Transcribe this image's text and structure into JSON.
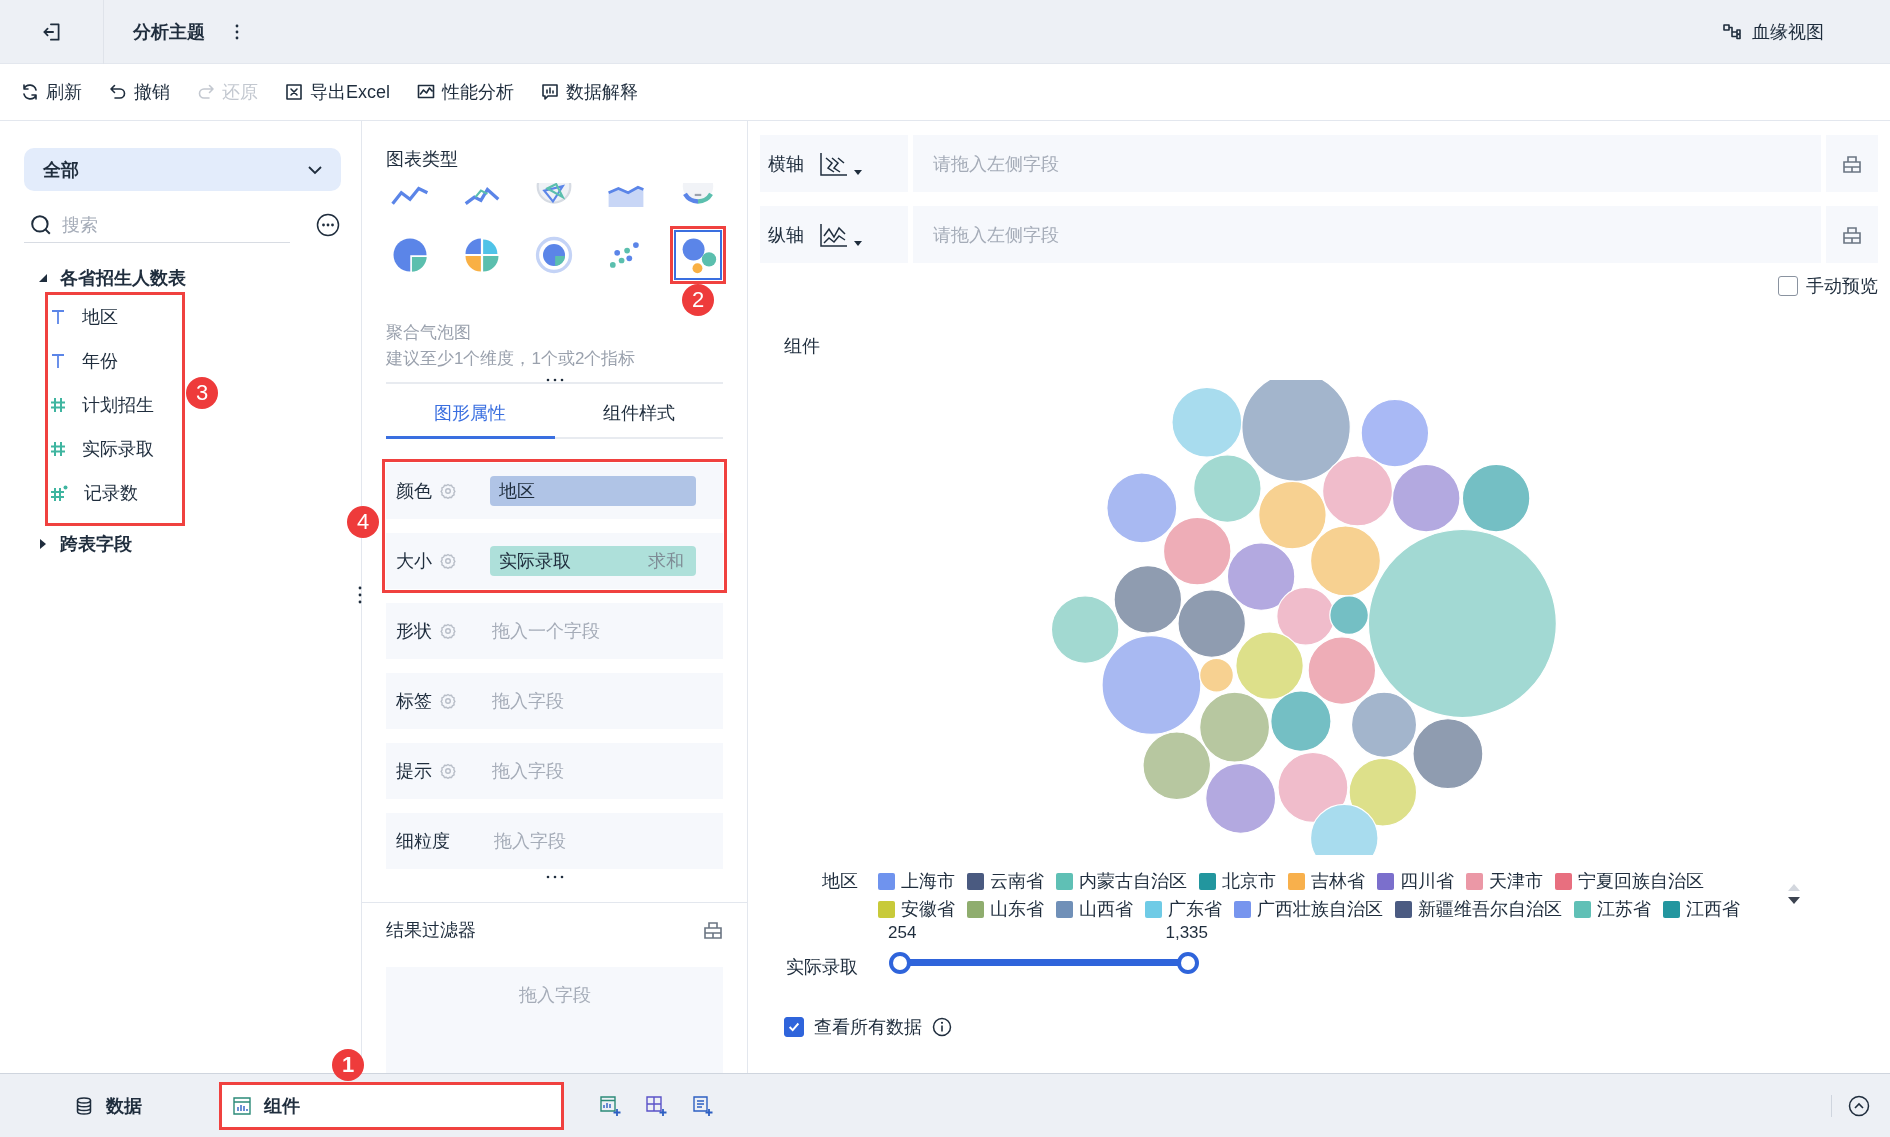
{
  "topbar": {
    "title": "分析主题",
    "lineage": "血缘视图"
  },
  "toolbar": [
    {
      "label": "刷新",
      "disabled": false
    },
    {
      "label": "撤销",
      "disabled": false
    },
    {
      "label": "还原",
      "disabled": true
    },
    {
      "label": "导出Excel",
      "disabled": false
    },
    {
      "label": "性能分析",
      "disabled": false
    },
    {
      "label": "数据解释",
      "disabled": false
    }
  ],
  "data_panel": {
    "scope": "全部",
    "search": {
      "placeholder": "搜索"
    },
    "tables": [
      {
        "name": "各省招生人数表",
        "expanded": true,
        "callout": "3",
        "fields": [
          {
            "name": "地区",
            "kind": "text"
          },
          {
            "name": "年份",
            "kind": "text"
          },
          {
            "name": "计划招生",
            "kind": "number"
          },
          {
            "name": "实际录取",
            "kind": "number"
          },
          {
            "name": "记录数",
            "kind": "count"
          }
        ]
      },
      {
        "name": "跨表字段",
        "expanded": false
      }
    ]
  },
  "chart_types": {
    "title": "图表类型",
    "items": [
      {
        "kind": "line",
        "selected": false
      },
      {
        "kind": "multiline",
        "selected": false
      },
      {
        "kind": "radar",
        "selected": false
      },
      {
        "kind": "area",
        "selected": false
      },
      {
        "kind": "gauge",
        "selected": false
      },
      {
        "kind": "pie",
        "selected": false
      },
      {
        "kind": "rose",
        "selected": false
      },
      {
        "kind": "ring",
        "selected": false
      },
      {
        "kind": "scatter",
        "selected": false
      },
      {
        "kind": "bubble",
        "selected": true,
        "callout": "2"
      }
    ],
    "name": "聚合气泡图",
    "hint": "建议至少1个维度，1个或2个指标"
  },
  "property_tabs": [
    {
      "label": "图形属性",
      "selected": true
    },
    {
      "label": "组件样式",
      "selected": false
    }
  ],
  "properties": {
    "callout": "4",
    "items": [
      {
        "label": "颜色",
        "settings": true,
        "kind": "dimension",
        "value": "地区"
      },
      {
        "label": "大小",
        "settings": true,
        "kind": "measure",
        "value": "实际录取",
        "aggregate": "求和"
      },
      {
        "label": "形状",
        "settings": true,
        "kind": "empty",
        "placeholder": "拖入一个字段"
      },
      {
        "label": "标签",
        "settings": true,
        "kind": "empty",
        "placeholder": "拖入字段"
      },
      {
        "label": "提示",
        "settings": true,
        "kind": "empty",
        "placeholder": "拖入字段"
      },
      {
        "label": "细粒度",
        "settings": false,
        "kind": "empty",
        "placeholder": "拖入字段"
      }
    ]
  },
  "result_filter": {
    "title": "结果过滤器",
    "placeholder": "拖入字段"
  },
  "axes": [
    {
      "label": "横轴",
      "kind": "x",
      "placeholder": "请拖入左侧字段"
    },
    {
      "label": "纵轴",
      "kind": "y",
      "placeholder": "请拖入左侧字段"
    }
  ],
  "manual_preview": {
    "label": "手动预览",
    "checked": false
  },
  "component": {
    "title": "组件",
    "legend": {
      "title": "地区",
      "items": [
        {
          "label": "上海市",
          "color": "#6f93ee"
        },
        {
          "label": "云南省",
          "color": "#4a5a80"
        },
        {
          "label": "内蒙古自治区",
          "color": "#5fc0b5"
        },
        {
          "label": "北京市",
          "color": "#22969e"
        },
        {
          "label": "吉林省",
          "color": "#f8b04c"
        },
        {
          "label": "四川省",
          "color": "#7b6fcc"
        },
        {
          "label": "天津市",
          "color": "#eb98a6"
        },
        {
          "label": "宁夏回族自治区",
          "color": "#e86f7f"
        },
        {
          "label": "安徽省",
          "color": "#c8ca3a"
        },
        {
          "label": "山东省",
          "color": "#8fad6e"
        },
        {
          "label": "山西省",
          "color": "#7090b8"
        },
        {
          "label": "广东省",
          "color": "#6fcbe6"
        },
        {
          "label": "广西壮族自治区",
          "color": "#7795ee"
        },
        {
          "label": "新疆维吾尔自治区",
          "color": "#4b5b82"
        },
        {
          "label": "江苏省",
          "color": "#60c0b6"
        },
        {
          "label": "江西省",
          "color": "#23969f"
        }
      ]
    },
    "size_filter": {
      "title": "实际录取",
      "min": "254",
      "max": "1,335"
    },
    "show_all": {
      "label": "查看所有数据",
      "checked": true
    }
  },
  "bottom_tabs": [
    {
      "label": "数据",
      "selected": false
    },
    {
      "label": "组件",
      "selected": true,
      "callout": "1"
    }
  ]
}
